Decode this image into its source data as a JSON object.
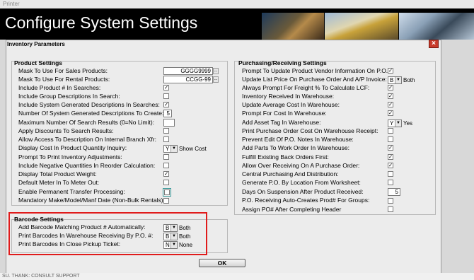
{
  "app": {
    "title": "Printer"
  },
  "banner": {
    "title": "Configure System Settings",
    "photos": [
      "banner-photo-1",
      "banner-photo-2",
      "banner-photo-3"
    ]
  },
  "statusbar": {
    "text": "SU. THANK: CONSULT SUPPORT"
  },
  "dialog": {
    "title": "Inventory Parameters",
    "close_icon": "close-icon",
    "ok_label": "OK"
  },
  "product": {
    "title": "Product Settings",
    "mask_sales": {
      "label": "Mask To Use For Sales Products:",
      "value": "GGGG9999",
      "button": "..."
    },
    "mask_rental": {
      "label": "Mask To Use For Rental Products:",
      "value": "CCGG-99",
      "button": "..."
    },
    "include_product_searches": {
      "label": "Include Product # In Searches:",
      "checked": true,
      "mark": "✓"
    },
    "include_group_desc": {
      "label": "Include Group Descriptions In Search:",
      "checked": false,
      "mark": ""
    },
    "include_system_desc": {
      "label": "Include System Generated Descriptions In Searches:",
      "checked": true,
      "mark": "✓"
    },
    "num_system_desc": {
      "label": "Number Of System Generated Descriptions To Create:",
      "value": "5"
    },
    "max_search_results": {
      "label": "Maximum Number Of Search Results (0=No Limit):",
      "value": ""
    },
    "apply_discounts": {
      "label": "Apply Discounts To Search Results:",
      "checked": false,
      "mark": ""
    },
    "allow_access_desc": {
      "label": "Allow Access To Description On Internal Branch Xfr:",
      "checked": false,
      "mark": ""
    },
    "display_cost": {
      "label": "Display Cost In Product Quantity Inquiry:",
      "value": "Y",
      "aside": "Show Cost"
    },
    "prompt_print_adjust": {
      "label": "Prompt To Print Inventory Adjustments:",
      "checked": false,
      "mark": ""
    },
    "include_negative": {
      "label": "Include Negative Quantities In Reorder Calculation:",
      "checked": false,
      "mark": ""
    },
    "display_total_weight": {
      "label": "Display Total Product Weight:",
      "checked": true,
      "mark": "✓"
    },
    "default_meter": {
      "label": "Default Meter In To Meter Out:",
      "checked": false,
      "mark": ""
    },
    "enable_transfer": {
      "label": "Enable Permanent Transfer Processing:",
      "checked": false,
      "mark": ""
    },
    "mandatory_make": {
      "label": "Mandatory Make/Model/Manf Date (Non-Bulk Rentals):",
      "checked": false,
      "mark": ""
    }
  },
  "barcode": {
    "title": "Barcode Settings",
    "add_matching": {
      "label": "Add Barcode Matching Product # Automatically:",
      "value": "B",
      "aside": "Both"
    },
    "print_receiving": {
      "label": "Print Barcodes In Warehouse Receiving By P.O. #:",
      "value": "B",
      "aside": "Both"
    },
    "print_close_pickup": {
      "label": "Print Barcodes In Close Pickup Ticket:",
      "value": "N",
      "aside": "None"
    }
  },
  "purchasing": {
    "title": "Purchasing/Receiving Settings",
    "prompt_update_vendor": {
      "label": "Prompt To Update Product Vendor Information On P.O.:",
      "checked": true,
      "mark": "✓"
    },
    "update_list_price": {
      "label": "Update List Price On Purchase Order And A/P Invoice:",
      "value": "B",
      "aside": "Both"
    },
    "always_prompt_freight": {
      "label": "Always Prompt For Freight % To Calculate LCF:",
      "checked": true,
      "mark": "✓"
    },
    "inventory_received": {
      "label": "Inventory Received In Warehouse:",
      "checked": true,
      "mark": "✓"
    },
    "update_average_cost": {
      "label": "Update Average Cost In Warehouse:",
      "checked": true,
      "mark": "✓"
    },
    "prompt_cost": {
      "label": "Prompt For Cost In Warehouse:",
      "checked": true,
      "mark": "✓"
    },
    "add_asset_tag": {
      "label": "Add Asset Tag In Warehouse:",
      "value": "Y",
      "aside": "Yes"
    },
    "print_po_cost": {
      "label": "Print Purchase Order Cost On Warehouse Receipt:",
      "checked": false,
      "mark": ""
    },
    "prevent_edit_notes": {
      "label": "Prevent Edit Of P.O. Notes In Warehouse:",
      "checked": false,
      "mark": ""
    },
    "add_parts_wo": {
      "label": "Add Parts To Work Order In Warehouse:",
      "checked": true,
      "mark": "✓"
    },
    "fulfill_back_orders": {
      "label": "Fulfill Existing Back Orders First:",
      "checked": true,
      "mark": "✓"
    },
    "allow_over_receiving": {
      "label": "Allow Over Receiving On A Purchase Order:",
      "checked": true,
      "mark": "✓"
    },
    "central_purchasing": {
      "label": "Central Purchasing And Distribution:",
      "checked": false,
      "mark": ""
    },
    "generate_po_location": {
      "label": "Generate P.O. By Location From Worksheet:",
      "checked": false,
      "mark": ""
    },
    "days_on_suspension": {
      "label": "Days On Suspension After Product Received:",
      "value": "5"
    },
    "po_receiving_auto": {
      "label": "P.O. Receiving Auto-Creates Prod# For Groups:",
      "checked": false,
      "mark": ""
    },
    "assign_po": {
      "label": "Assign PO# After Completing Header",
      "checked": false,
      "mark": ""
    }
  }
}
